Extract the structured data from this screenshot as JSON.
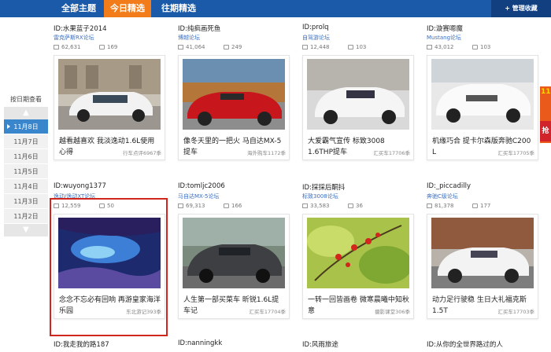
{
  "tabs": [
    {
      "label": "全部主题"
    },
    {
      "label": "今日精选"
    },
    {
      "label": "往期精选"
    }
  ],
  "manage_button": "+ 管理收藏",
  "sidebar": {
    "title": "按日期查看",
    "dates": [
      "11月8日",
      "11月7日",
      "11月6日",
      "11月5日",
      "11月4日",
      "11月3日",
      "11月2日"
    ],
    "active_index": 0
  },
  "cards": [
    {
      "id": "ID:水果蓝子2014",
      "forum": "雷克萨斯RX论坛",
      "views": "62,631",
      "replies": "169",
      "title": "越看越喜欢 我淡逸动1.6L使用心得",
      "source": "行车点评6967季"
    },
    {
      "id": "ID:纯疯画死鱼",
      "forum": "博越论坛",
      "views": "41,064",
      "replies": "249",
      "title": "像冬天里的一把火 马自达MX-5提车",
      "source": "海外购车1172季"
    },
    {
      "id": "ID:prolq",
      "forum": "自驾游论坛",
      "views": "12,448",
      "replies": "103",
      "title": "大爱霸气宣传 标致3008 1.6THP提车",
      "source": "汇买车17706季"
    },
    {
      "id": "ID:漩赛嗯魔",
      "forum": "Mustang论坛",
      "views": "43,012",
      "replies": "103",
      "title": "机缘巧合 提卡尔森版奔驰C200 L",
      "source": "汇买车17705季"
    },
    {
      "id": "ID:wuyong1377",
      "forum": "逸动/逸动XT论坛",
      "views": "12,559",
      "replies": "50",
      "title": "念念不忘必有回响 再游皇家海洋乐园",
      "source": "东北游记393季"
    },
    {
      "id": "ID:tomljc2006",
      "forum": "马自达MX-5论坛",
      "views": "69,313",
      "replies": "166",
      "title": "人生第一部买菜车 昕锐1.6L提车记",
      "source": "汇买车17704季"
    },
    {
      "id": "ID:採採后酮抖",
      "forum": "标致3008论坛",
      "views": "33,583",
      "replies": "36",
      "title": "一转一回皆画卷 微寒晨曦中知秋意",
      "source": "摄影课堂306季"
    },
    {
      "id": "ID:_piccadilly",
      "forum": "奔驰C级论坛",
      "views": "81,378",
      "replies": "177",
      "title": "动力足行驶稳 生日大礼福克斯1.5T",
      "source": "汇买车17703季"
    }
  ],
  "bottom_ids": [
    "ID:我走我的路187",
    "ID:nanningkk",
    "ID:风雨旅途",
    "ID:从你的全世界路过的人"
  ],
  "edge_ad": {
    "text1": "11",
    "text2": "抢"
  },
  "colors": {
    "topbar": "#1a5aa8",
    "active_tab": "#f27c1a",
    "active_date": "#3a86cc",
    "highlight": "#d0261d"
  }
}
